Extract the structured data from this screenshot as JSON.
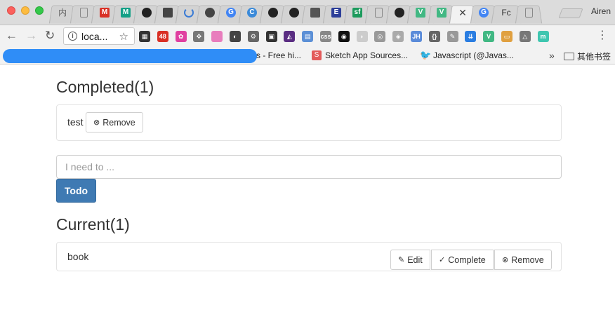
{
  "browser": {
    "tabs": [
      {
        "label": "内",
        "icon": "text-icon",
        "color": "#666666"
      },
      {
        "label": "",
        "icon": "page-icon",
        "color": "#888888"
      },
      {
        "label": "M",
        "icon": "gmail-icon",
        "color": "#d93025"
      },
      {
        "label": "M",
        "icon": "medium-icon",
        "color": "#13a086"
      },
      {
        "label": "",
        "icon": "github-icon",
        "color": "#222222"
      },
      {
        "label": "",
        "icon": "robot-icon",
        "color": "#444444"
      },
      {
        "label": "",
        "icon": "loading-icon",
        "color": "#3a7bd5"
      },
      {
        "label": "",
        "icon": "cloud-icon",
        "color": "#444444"
      },
      {
        "label": "G",
        "icon": "google-icon",
        "color": "#4285f4"
      },
      {
        "label": "C",
        "icon": "c-icon",
        "color": "#3b8ad9"
      },
      {
        "label": "",
        "icon": "github-icon",
        "color": "#222222"
      },
      {
        "label": "",
        "icon": "github-icon",
        "color": "#222222"
      },
      {
        "label": "",
        "icon": "square-icon",
        "color": "#555555"
      },
      {
        "label": "E",
        "icon": "e-icon",
        "color": "#2c3e99"
      },
      {
        "label": "sf",
        "icon": "sf-icon",
        "color": "#1c9b5d"
      },
      {
        "label": "",
        "icon": "page-icon",
        "color": "#888888"
      },
      {
        "label": "",
        "icon": "github-icon",
        "color": "#222222"
      },
      {
        "label": "V",
        "icon": "vue-icon",
        "color": "#41b883"
      },
      {
        "label": "V",
        "icon": "vue-icon",
        "color": "#41b883"
      },
      {
        "label": "✕",
        "icon": "close-icon",
        "color": "#444444"
      },
      {
        "label": "G",
        "icon": "google-icon",
        "color": "#4285f4"
      },
      {
        "label": "Fc",
        "icon": "text-icon",
        "color": "#333333"
      },
      {
        "label": "",
        "icon": "page-icon",
        "color": "#888888"
      }
    ],
    "active_tab_index": 19,
    "profile_name": "Airen",
    "url": "loca...",
    "extensions": [
      {
        "label": "▦",
        "color": "#333333"
      },
      {
        "label": "48",
        "color": "#d93025"
      },
      {
        "label": "✿",
        "color": "#e040a0"
      },
      {
        "label": "✥",
        "color": "#777777"
      },
      {
        "label": "",
        "color": "#e87dbd"
      },
      {
        "label": "◐",
        "color": "#444444"
      },
      {
        "label": "⚙",
        "color": "#666666"
      },
      {
        "label": "▣",
        "color": "#333333"
      },
      {
        "label": "◭",
        "color": "#5a2d82"
      },
      {
        "label": "▤",
        "color": "#5b8fd6"
      },
      {
        "label": "css",
        "color": "#888888"
      },
      {
        "label": "◉",
        "color": "#111111"
      },
      {
        "label": "◗",
        "color": "#cccccc"
      },
      {
        "label": "◎",
        "color": "#999999"
      },
      {
        "label": "◈",
        "color": "#aaaaaa"
      },
      {
        "label": "JH",
        "color": "#5a8bd9"
      },
      {
        "label": "{}",
        "color": "#666666"
      },
      {
        "label": "✎",
        "color": "#999999"
      },
      {
        "label": "⇊",
        "color": "#2a7de1"
      },
      {
        "label": "V",
        "color": "#41b883"
      },
      {
        "label": "▭",
        "color": "#e0a040"
      },
      {
        "label": "△",
        "color": "#777777"
      },
      {
        "label": "m",
        "color": "#3fc6b0"
      }
    ],
    "bookmarks": [
      {
        "label": "s - Free hi...",
        "icon": "blurred-icon",
        "color": "#2f8df7"
      },
      {
        "label": "Sketch App Sources...",
        "icon": "sketch-icon",
        "color": "#e35a5a"
      },
      {
        "label": "Javascript (@Javas...",
        "icon": "twitter-icon",
        "color": "#1da1f2"
      }
    ],
    "more_bookmarks_label": "»",
    "other_bookmarks_label": "其他书签"
  },
  "completed": {
    "heading": "Completed(1)",
    "items": [
      {
        "text": "test"
      }
    ],
    "remove_label": "Remove"
  },
  "new_todo": {
    "placeholder": "I need to ...",
    "button_label": "Todo"
  },
  "current": {
    "heading": "Current(1)",
    "items": [
      {
        "text": "book"
      }
    ],
    "edit_label": "Edit",
    "complete_label": "Complete",
    "remove_label": "Remove"
  },
  "colors": {
    "primary": "#3f7ab3",
    "border": "#e3e3e3",
    "text": "#333333"
  }
}
